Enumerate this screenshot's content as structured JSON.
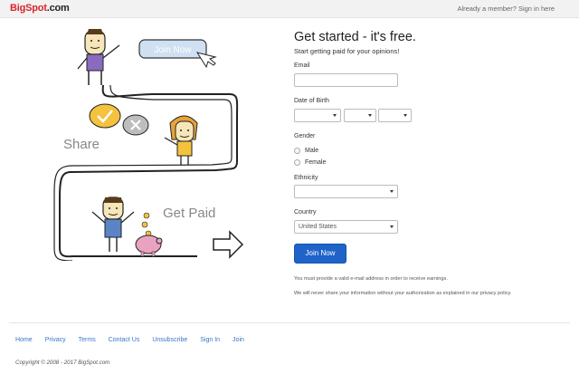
{
  "header": {
    "logo_bold": "BigSpot",
    "logo_domain": ".com",
    "member_link": "Already a member? Sign in here"
  },
  "illustration": {
    "join_now": "Join Now",
    "share": "Share",
    "get_paid": "Get Paid"
  },
  "form": {
    "title": "Get started - it's free.",
    "subtitle": "Start getting paid for your opinions!",
    "email_label": "Email",
    "email_value": "",
    "dob_label": "Date of Birth",
    "gender_label": "Gender",
    "gender_options": [
      "Male",
      "Female"
    ],
    "ethnicity_label": "Ethnicity",
    "ethnicity_value": "",
    "country_label": "Country",
    "country_value": "United States",
    "join_button": "Join Now",
    "note_1": "You must provide a valid e-mail address in order to receive earnings.",
    "note_2": "We will never share your information without your authorization as explained in our privacy policy."
  },
  "footer": {
    "links": [
      "Home",
      "Privacy",
      "Terms",
      "Contact Us",
      "Unsubscribe",
      "Sign In",
      "Join"
    ],
    "copyright": "Copyright © 2008 - 2017 BigSpot.com"
  },
  "colors": {
    "brand_red": "#d7262b",
    "accent_blue": "#1f63c9",
    "link_blue": "#3b74c9"
  }
}
